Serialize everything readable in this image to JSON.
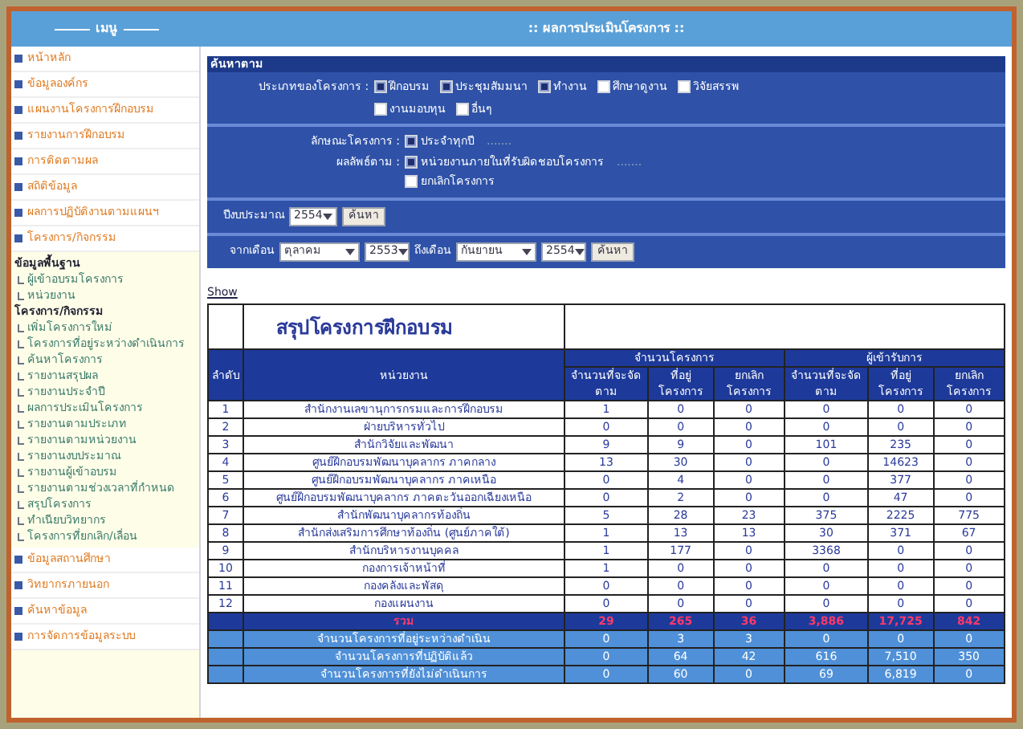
{
  "sidebar": {
    "title": "เมนู",
    "top_items": [
      "หน้าหลัก",
      "ข้อมูลองค์กร",
      "แผนงานโครงการฝึกอบรม",
      "รายงานการฝึกอบรม",
      "การติดตามผล",
      "สถิติข้อมูล",
      "ผลการปฏิบัติงานตามแผนฯ",
      "โครงการ/กิจกรรม"
    ],
    "groups": [
      {
        "title": "ข้อมูลพื้นฐาน",
        "children": [
          "ผู้เข้าอบรมโครงการ",
          "หน่วยงาน"
        ]
      },
      {
        "title": "โครงการ/กิจกรรม",
        "children": [
          "เพิ่มโครงการใหม่",
          "โครงการที่อยู่ระหว่างดำเนินการ",
          "ค้นหาโครงการ",
          "รายงานสรุปผล",
          "รายงานประจำปี",
          "ผลการประเมินโครงการ",
          "รายงานตามประเภท",
          "รายงานตามหน่วยงาน",
          "รายงานงบประมาณ",
          "รายงานผู้เข้าอบรม",
          "รายงานตามช่วงเวลาที่กำหนด",
          "สรุปโครงการ",
          "ทำเนียบวิทยากร",
          "โครงการที่ยกเลิก/เลื่อน"
        ]
      }
    ],
    "bottom_items": [
      "ข้อมูลสถานศึกษา",
      "วิทยากรภายนอก",
      "ค้นหาข้อมูล",
      "การจัดการข้อมูลระบบ"
    ]
  },
  "header": {
    "title": ":: ผลการประเมินโครงการ ::"
  },
  "filter": {
    "title": "ค้นหาตาม",
    "type_label": "ประเภทของโครงการ :",
    "types": [
      {
        "label": "ฝึกอบรม",
        "checked": true
      },
      {
        "label": "ประชุมสัมมนา",
        "checked": true
      },
      {
        "label": "ทำงาน",
        "checked": true
      },
      {
        "label": "ศึกษาดูงาน",
        "checked": false
      },
      {
        "label": "วิจัยสรรพ",
        "checked": false
      },
      {
        "label": "งานมอบทุน",
        "checked": false
      },
      {
        "label": "อื่นๆ",
        "checked": false
      }
    ],
    "nature_label": "ลักษณะโครงการ :",
    "natures": [
      {
        "label": "ประจำทุกปี",
        "checked": true,
        "note": "......."
      }
    ],
    "result_label": "ผลลัพธ์ตาม :",
    "results": [
      {
        "label": "หน่วยงานภายในที่รับผิดชอบโครงการ",
        "checked": true,
        "note": "......."
      },
      {
        "label": "ยกเลิกโครงการ",
        "checked": false
      }
    ],
    "year_label": "ปีงบประมาณ",
    "year": "2554",
    "year_button": "ค้นหา",
    "from_label": "จากเดือน",
    "from_month": "ตุลาคม",
    "from_year": "2553",
    "to_label": "ถึงเดือน",
    "to_month": "กันยายน",
    "to_year": "2554",
    "range_button": "ค้นหา"
  },
  "show_link": "Show",
  "table": {
    "title": "สรุปโครงการฝึกอบรม",
    "group_a": "จำนวนโครงการ",
    "group_b": "ผู้เข้ารับการ",
    "columns": [
      "ลำดับ",
      "หน่วยงาน",
      "จำนวนที่จะจัด ตาม",
      "ที่อยู่ โครงการ",
      "ยกเลิก โครงการ",
      "จำนวนที่จะจัด ตาม",
      "ที่อยู่ โครงการ",
      "ยกเลิก โครงการ"
    ],
    "rows": [
      [
        "1",
        "สำนักงานเลขานุการกรมและการฝึกอบรม",
        "1",
        "0",
        "0",
        "0",
        "0",
        "0"
      ],
      [
        "2",
        "ฝ่ายบริหารทั่วไป",
        "0",
        "0",
        "0",
        "0",
        "0",
        "0"
      ],
      [
        "3",
        "สำนักวิจัยและพัฒนา",
        "9",
        "9",
        "0",
        "101",
        "235",
        "0"
      ],
      [
        "4",
        "ศูนย์ฝึกอบรมพัฒนาบุคลากร ภาคกลาง",
        "13",
        "30",
        "0",
        "0",
        "14623",
        "0"
      ],
      [
        "5",
        "ศูนย์ฝึกอบรมพัฒนาบุคลากร ภาคเหนือ",
        "0",
        "4",
        "0",
        "0",
        "377",
        "0"
      ],
      [
        "6",
        "ศูนย์ฝึกอบรมพัฒนาบุคลากร ภาคตะวันออกเฉียงเหนือ",
        "0",
        "2",
        "0",
        "0",
        "47",
        "0"
      ],
      [
        "7",
        "สำนักพัฒนาบุคลากรท้องถิ่น",
        "5",
        "28",
        "23",
        "375",
        "2225",
        "775"
      ],
      [
        "8",
        "สำนักส่งเสริมการศึกษาท้องถิ่น (ศูนย์ภาคใต้)",
        "1",
        "13",
        "13",
        "30",
        "371",
        "67"
      ],
      [
        "9",
        "สำนักบริหารงานบุคคล",
        "1",
        "177",
        "0",
        "3368",
        "0",
        "0"
      ],
      [
        "10",
        "กองการเจ้าหน้าที่",
        "1",
        "0",
        "0",
        "0",
        "0",
        "0"
      ],
      [
        "11",
        "กองคลังและพัสดุ",
        "0",
        "0",
        "0",
        "0",
        "0",
        "0"
      ],
      [
        "12",
        "กองแผนงาน",
        "0",
        "0",
        "0",
        "0",
        "0",
        "0"
      ]
    ],
    "total": [
      "รวม",
      "29",
      "265",
      "36",
      "3,886",
      "17,725",
      "842"
    ],
    "summary": [
      [
        "จำนวนโครงการที่อยู่ระหว่างดำเนิน",
        "0",
        "3",
        "3",
        "0",
        "0",
        "0"
      ],
      [
        "จำนวนโครงการที่ปฏิบัติแล้ว",
        "0",
        "64",
        "42",
        "616",
        "7,510",
        "350"
      ],
      [
        "จำนวนโครงการที่ยังไม่ดำเนินการ",
        "0",
        "60",
        "0",
        "69",
        "6,819",
        "0"
      ]
    ]
  }
}
